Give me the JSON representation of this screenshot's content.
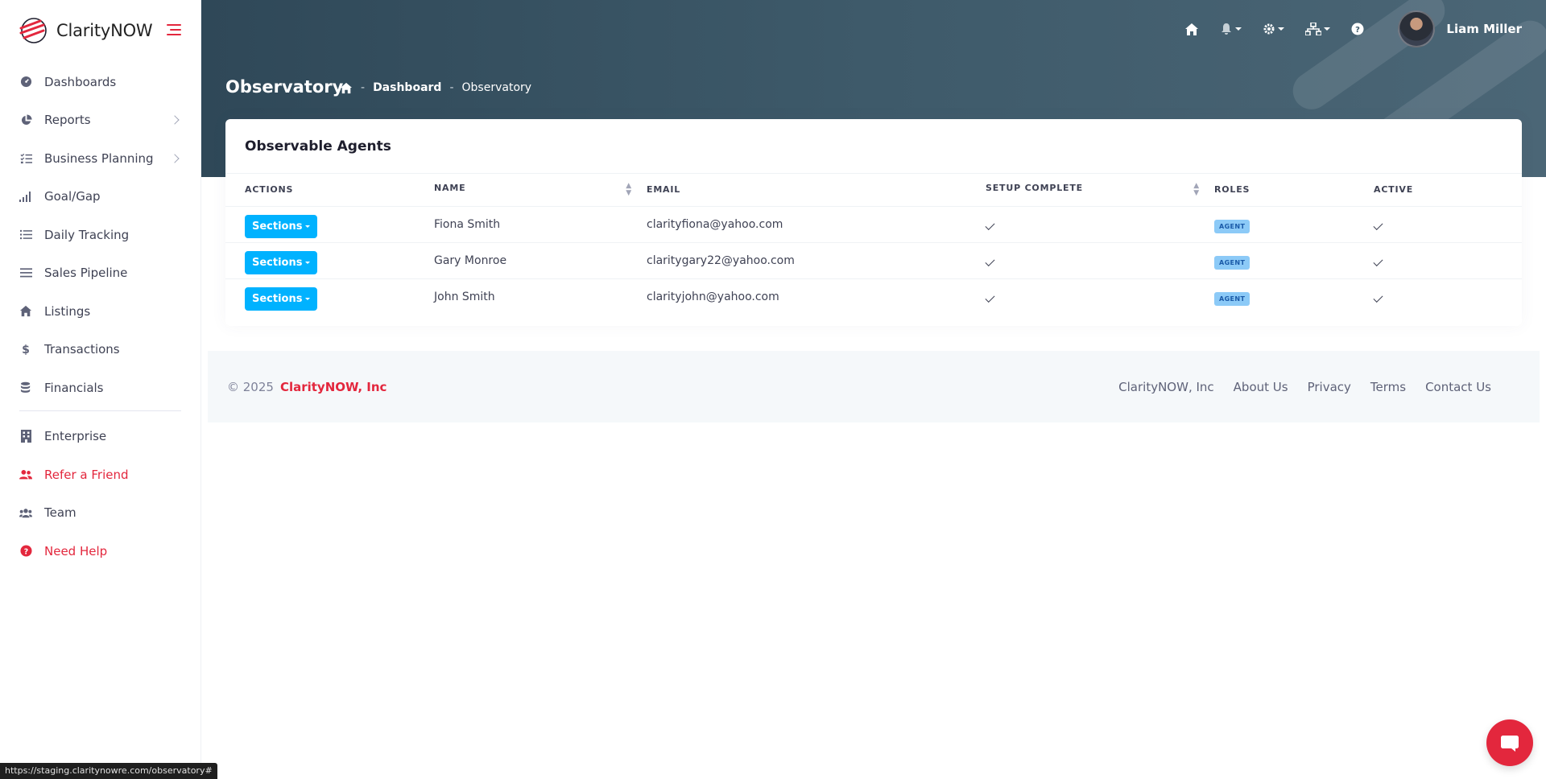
{
  "brand": {
    "name": "ClarityNOW"
  },
  "sidebar": {
    "items": [
      {
        "label": "Dashboards",
        "icon": "gauge-icon",
        "chevron": false
      },
      {
        "label": "Reports",
        "icon": "pie-chart-icon",
        "chevron": true
      },
      {
        "label": "Business Planning",
        "icon": "task-list-icon",
        "chevron": true
      },
      {
        "label": "Goal/Gap",
        "icon": "signal-bars-icon",
        "chevron": false
      },
      {
        "label": "Daily Tracking",
        "icon": "list-icon",
        "chevron": false
      },
      {
        "label": "Sales Pipeline",
        "icon": "lines-icon",
        "chevron": false
      },
      {
        "label": "Listings",
        "icon": "home-icon",
        "chevron": false
      },
      {
        "label": "Transactions",
        "icon": "dollar-icon",
        "chevron": false
      },
      {
        "label": "Financials",
        "icon": "coins-icon",
        "chevron": false
      }
    ],
    "bottom_items": [
      {
        "label": "Enterprise",
        "icon": "building-icon",
        "accent": false
      },
      {
        "label": "Refer a Friend",
        "icon": "user-friends-icon",
        "accent": true
      },
      {
        "label": "Team",
        "icon": "users-icon",
        "accent": false
      },
      {
        "label": "Need Help",
        "icon": "question-circle-icon",
        "accent": true
      }
    ]
  },
  "header": {
    "user_name": "Liam Miller",
    "page_title": "Observatory",
    "breadcrumb": {
      "level1": "Dashboard",
      "level2": "Observatory"
    }
  },
  "card": {
    "title": "Observable Agents",
    "columns": [
      "ACTIONS",
      "NAME",
      "EMAIL",
      "SETUP COMPLETE",
      "ROLES",
      "ACTIVE"
    ],
    "action_label": "Sections",
    "rows": [
      {
        "name": "Fiona Smith",
        "email": "clarityfiona@yahoo.com",
        "setup_complete": true,
        "role": "AGENT",
        "active": true
      },
      {
        "name": "Gary Monroe",
        "email": "claritygary22@yahoo.com",
        "setup_complete": true,
        "role": "AGENT",
        "active": true
      },
      {
        "name": "John Smith",
        "email": "clarityjohn@yahoo.com",
        "setup_complete": true,
        "role": "AGENT",
        "active": true
      }
    ]
  },
  "footer": {
    "copyright": "© 2025",
    "company": "ClarityNOW, Inc",
    "links": [
      "ClarityNOW, Inc",
      "About Us",
      "Privacy",
      "Terms",
      "Contact Us"
    ]
  },
  "status_url": "https://staging.claritynowre.com/observatory#",
  "colors": {
    "accent": "#e3273d",
    "header": "#3e5a6a",
    "button": "#00b2ff",
    "badge": "#8ccaf7"
  }
}
